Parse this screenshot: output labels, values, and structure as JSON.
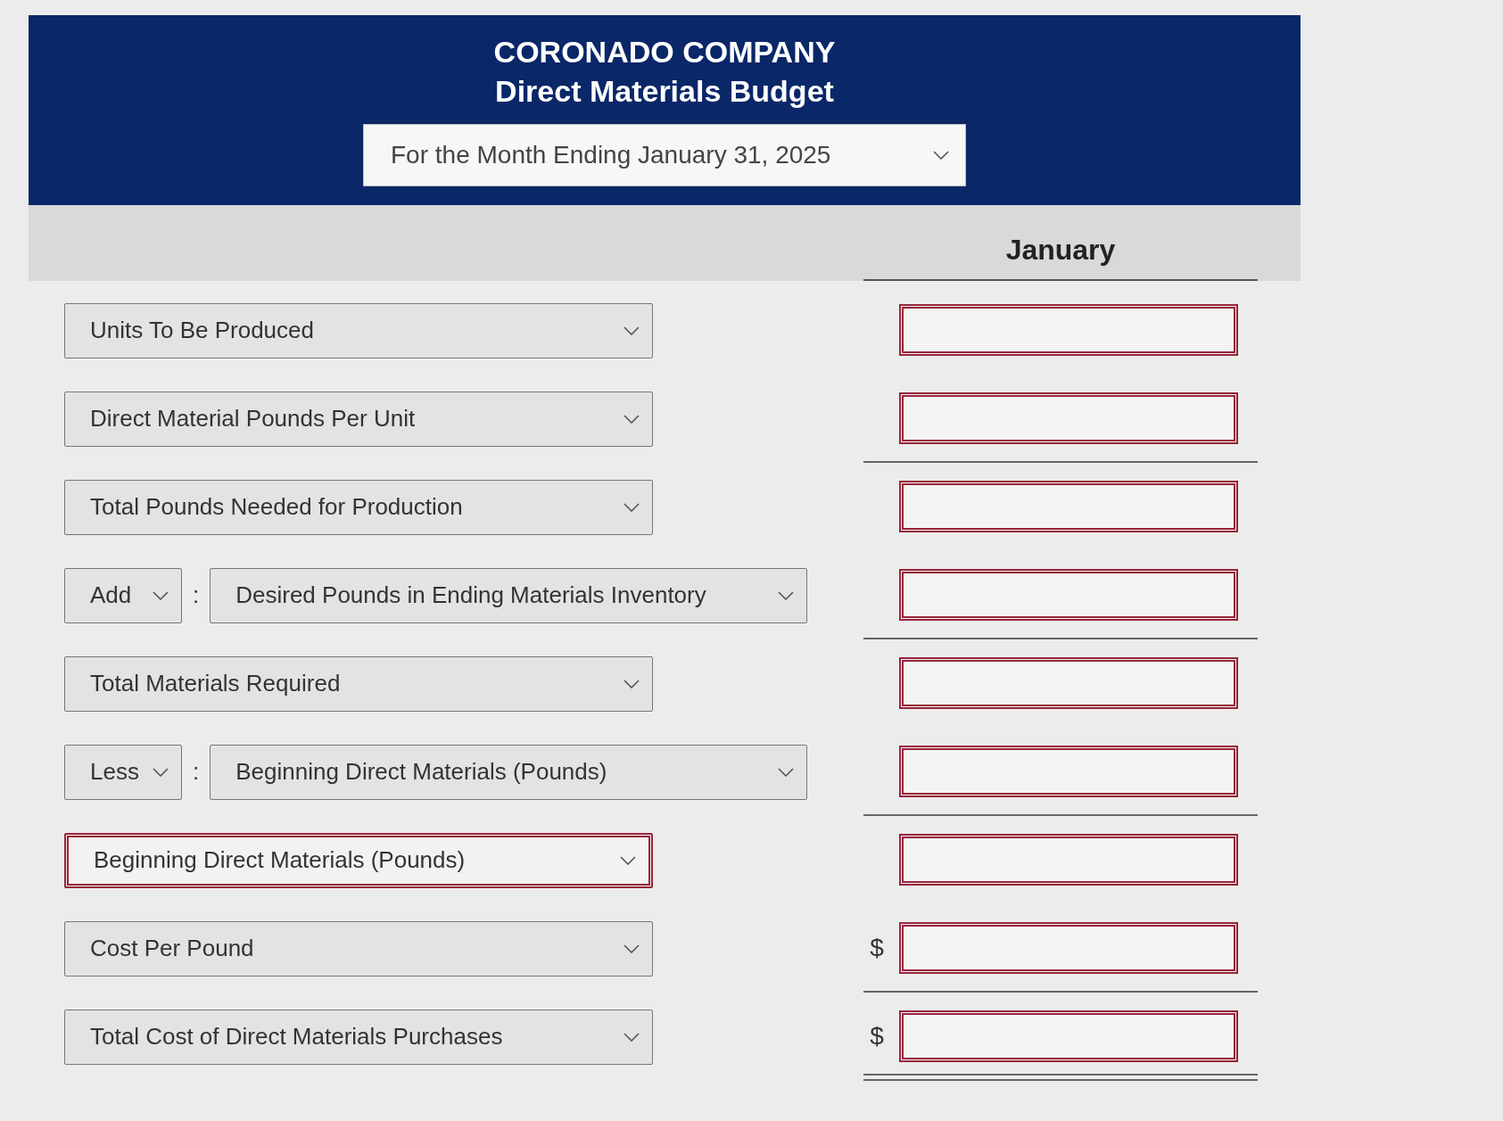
{
  "header": {
    "company": "CORONADO COMPANY",
    "title": "Direct Materials Budget",
    "period": {
      "value": "For the Month Ending January 31, 2025"
    }
  },
  "column_header": "January",
  "rows": [
    {
      "kind": "line",
      "label": {
        "value": "Units To Be Produced",
        "incorrect": false
      },
      "amount": {
        "incorrect": true
      },
      "rule_below": false,
      "double_rule": false
    },
    {
      "kind": "line",
      "label": {
        "value": "Direct Material Pounds Per Unit",
        "incorrect": false
      },
      "amount": {
        "incorrect": true
      },
      "rule_below": true,
      "double_rule": false
    },
    {
      "kind": "line",
      "label": {
        "value": "Total Pounds Needed for Production",
        "incorrect": false
      },
      "amount": {
        "incorrect": true
      },
      "rule_below": false,
      "double_rule": false
    },
    {
      "kind": "adjustment",
      "operator": {
        "value": "Add",
        "incorrect": false
      },
      "separator": ":",
      "label": {
        "value": "Desired Pounds in Ending Materials Inventory",
        "incorrect": false
      },
      "amount": {
        "incorrect": true
      },
      "rule_below": true,
      "double_rule": false
    },
    {
      "kind": "line",
      "label": {
        "value": "Total Materials Required",
        "incorrect": false
      },
      "amount": {
        "incorrect": true
      },
      "rule_below": false,
      "double_rule": false
    },
    {
      "kind": "adjustment",
      "operator": {
        "value": "Less",
        "incorrect": false
      },
      "separator": ":",
      "label": {
        "value": "Beginning Direct Materials (Pounds)",
        "incorrect": false
      },
      "amount": {
        "incorrect": true
      },
      "rule_below": true,
      "double_rule": false
    },
    {
      "kind": "line",
      "label": {
        "value": "Beginning Direct Materials (Pounds)",
        "incorrect": true
      },
      "amount": {
        "incorrect": true
      },
      "rule_below": false,
      "double_rule": false
    },
    {
      "kind": "line",
      "label": {
        "value": "Cost Per Pound",
        "incorrect": false
      },
      "amount": {
        "currency": "$",
        "incorrect": true
      },
      "rule_below": true,
      "double_rule": false
    },
    {
      "kind": "line",
      "label": {
        "value": "Total Cost of Direct Materials Purchases",
        "incorrect": false
      },
      "amount": {
        "currency": "$",
        "incorrect": true
      },
      "rule_below": true,
      "double_rule": true
    }
  ]
}
